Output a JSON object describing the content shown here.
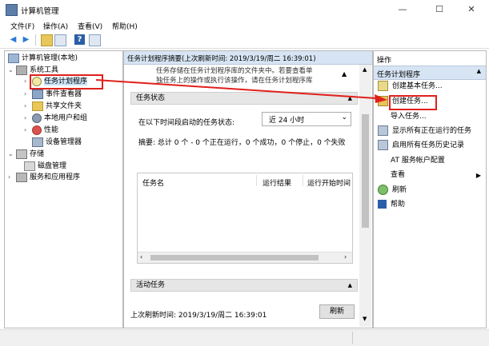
{
  "window": {
    "title": "计算机管理"
  },
  "menu": [
    "文件(F)",
    "操作(A)",
    "查看(V)",
    "帮助(H)"
  ],
  "tree": {
    "root": "计算机管理(本地)",
    "system_tools": "系统工具",
    "task_scheduler": "任务计划程序",
    "event_viewer": "事件查看器",
    "shared_folders": "共享文件夹",
    "local_users": "本地用户和组",
    "performance": "性能",
    "device_manager": "设备管理器",
    "storage": "存储",
    "disk_management": "磁盘管理",
    "services_apps": "服务和应用程序"
  },
  "middle": {
    "header": "任务计划程序摘要(上次刷新时间: 2019/3/19/周二 16:39:01)",
    "overview_line1": "任务存储在任务计划程序库的文件夹中。若要查看单",
    "overview_line2": "独任务上的操作或执行该操作，请在任务计划程序库",
    "task_status_title": "任务状态",
    "status_label": "在以下时间段启动的任务状态:",
    "status_select": "近 24 小时",
    "summary": "摘要: 总计 0 个 - 0 个正在运行，0 个成功，0 个停止，0 个失败",
    "columns": [
      "任务名",
      "运行结果",
      "运行开始时间"
    ],
    "active_tasks_title": "活动任务",
    "last_refresh": "上次刷新时间: 2019/3/19/周二 16:39:01",
    "refresh_button": "刷新"
  },
  "actions": {
    "title": "操作",
    "section": "任务计划程序",
    "items": [
      "创建基本任务...",
      "创建任务...",
      "导入任务...",
      "显示所有正在运行的任务",
      "启用所有任务历史记录",
      "AT 服务帐户配置",
      "查看",
      "刷新",
      "帮助"
    ]
  }
}
